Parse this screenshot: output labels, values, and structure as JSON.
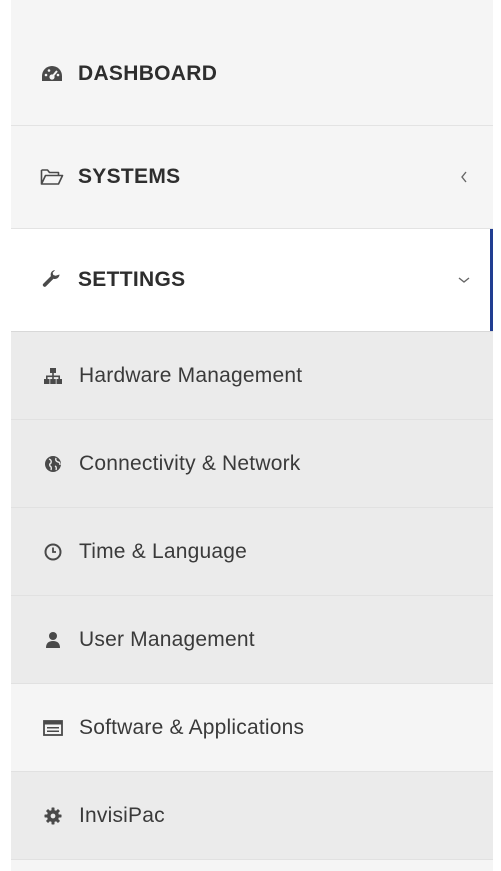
{
  "nav": {
    "dashboard": {
      "label": "DASHBOARD",
      "icon": "dashboard-icon"
    },
    "systems": {
      "label": "SYSTEMS",
      "icon": "folder-open-icon",
      "chevron": "chevron-left-icon"
    },
    "settings": {
      "label": "SETTINGS",
      "icon": "wrench-icon",
      "chevron": "chevron-down-icon",
      "active": true
    }
  },
  "submenu": {
    "items": [
      {
        "label": "Hardware Management",
        "icon": "sitemap-icon"
      },
      {
        "label": "Connectivity & Network",
        "icon": "globe-icon"
      },
      {
        "label": "Time & Language",
        "icon": "clock-icon"
      },
      {
        "label": "User Management",
        "icon": "user-icon"
      },
      {
        "label": "Software & Applications",
        "icon": "window-icon"
      },
      {
        "label": "InvisiPac",
        "icon": "gear-icon"
      }
    ]
  },
  "colors": {
    "active_indicator": "#213d91",
    "icon": "#4a4a4a"
  }
}
